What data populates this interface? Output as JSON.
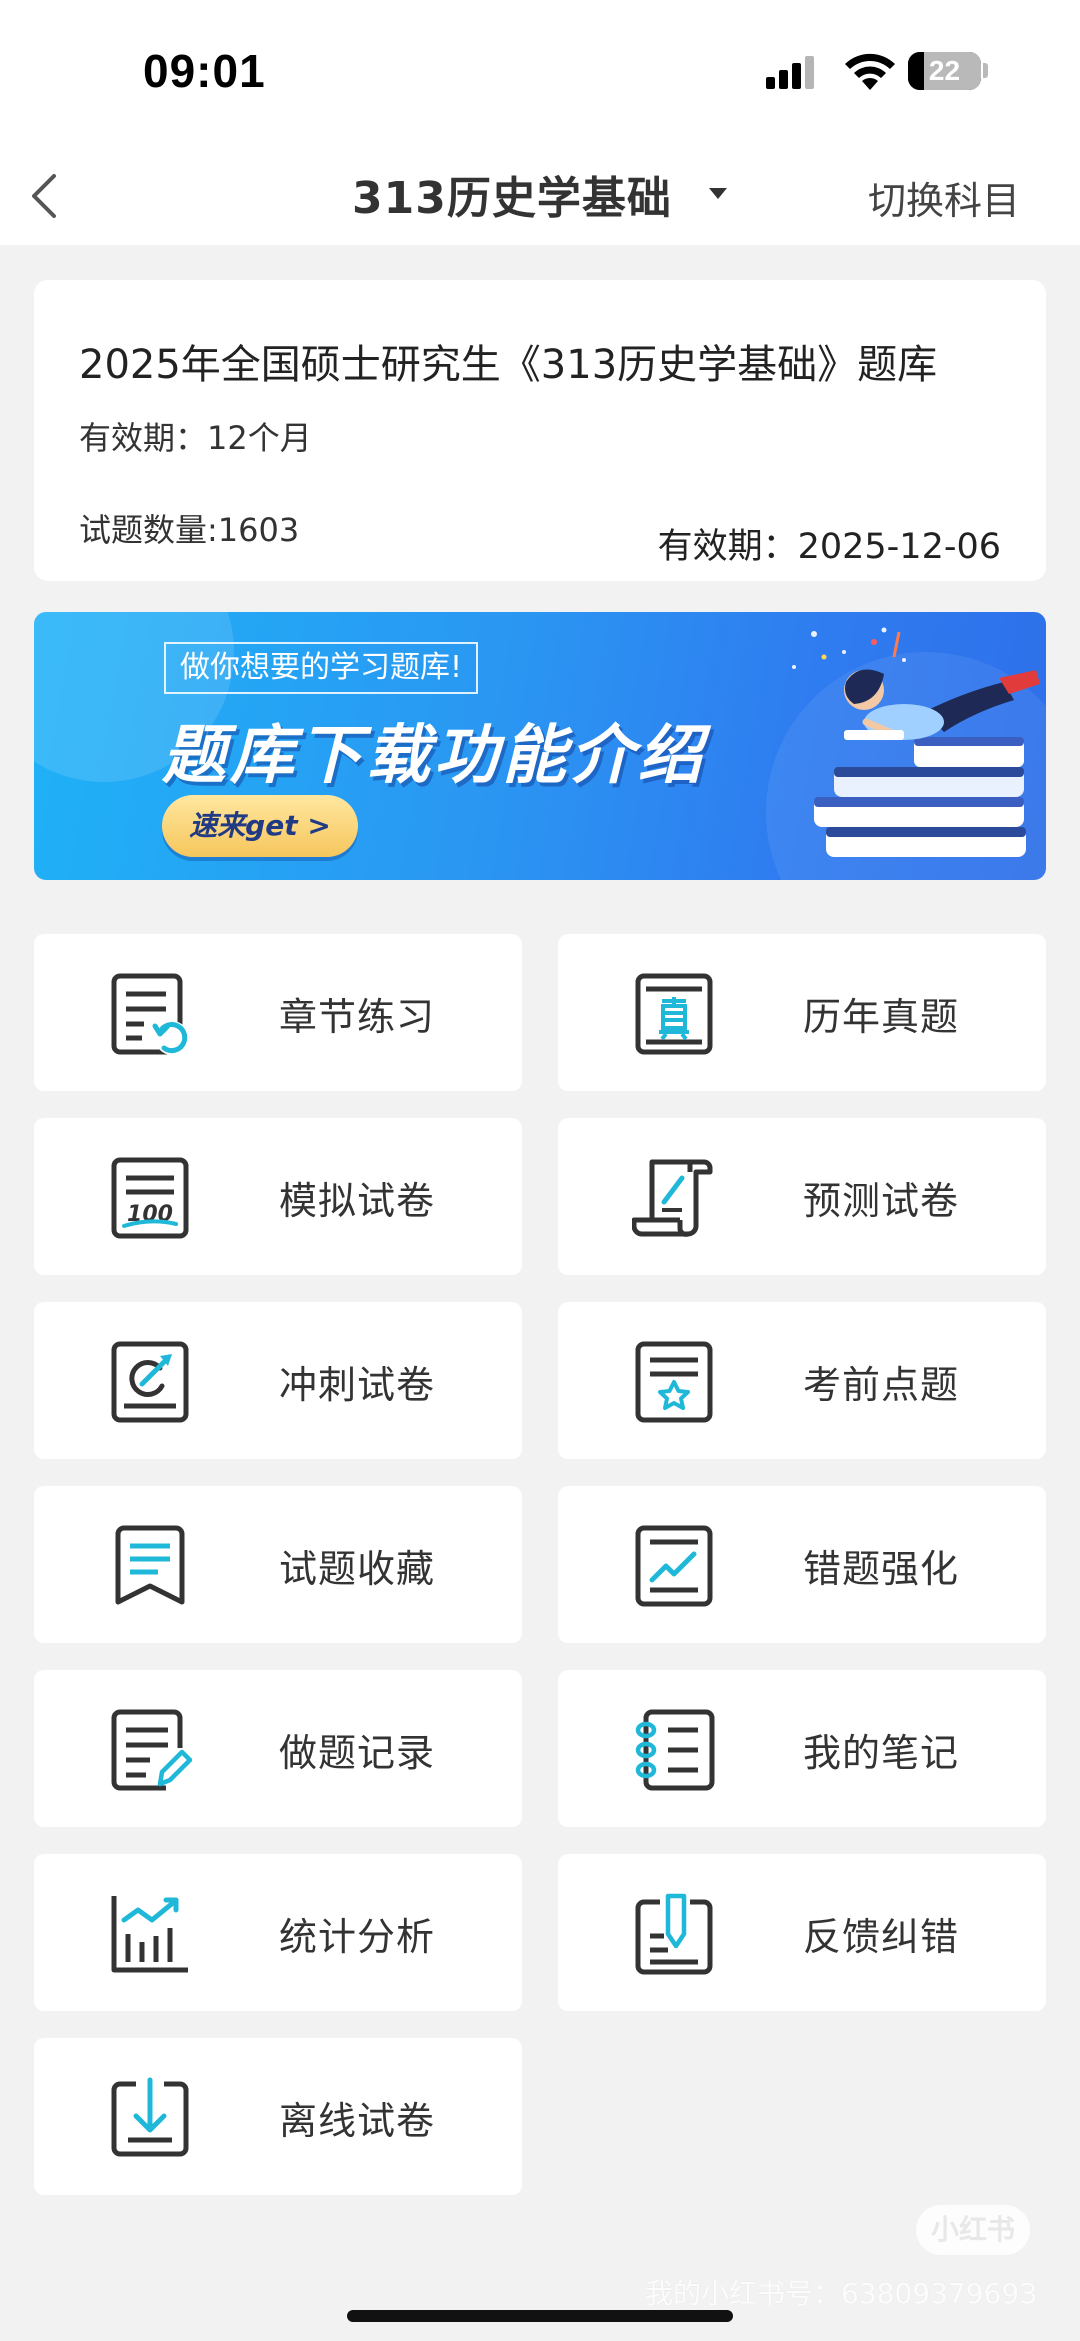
{
  "status_bar": {
    "time": "09:01",
    "battery": "22",
    "battery_level_percent": 22
  },
  "nav": {
    "title": "313历史学基础",
    "switch_label": "切换科目"
  },
  "info_card": {
    "title": "2025年全国硕士研究生《313历史学基础》题库",
    "validity": "有效期：12个月",
    "question_count": "试题数量:1603",
    "expire": "有效期：2025-12-06"
  },
  "banner": {
    "tag": "做你想要的学习题库!",
    "title": "题库下载功能介绍",
    "button": "速来get >"
  },
  "menu": [
    {
      "label": "章节练习",
      "icon": "chapter-practice-icon"
    },
    {
      "label": "历年真题",
      "icon": "past-exams-icon"
    },
    {
      "label": "模拟试卷",
      "icon": "mock-paper-icon"
    },
    {
      "label": "预测试卷",
      "icon": "forecast-paper-icon"
    },
    {
      "label": "冲刺试卷",
      "icon": "sprint-paper-icon"
    },
    {
      "label": "考前点题",
      "icon": "pre-exam-tips-icon"
    },
    {
      "label": "试题收藏",
      "icon": "favorites-icon"
    },
    {
      "label": "错题强化",
      "icon": "wrong-questions-icon"
    },
    {
      "label": "做题记录",
      "icon": "practice-record-icon"
    },
    {
      "label": "我的笔记",
      "icon": "notes-icon"
    },
    {
      "label": "统计分析",
      "icon": "statistics-icon"
    },
    {
      "label": "反馈纠错",
      "icon": "feedback-icon"
    },
    {
      "label": "离线试卷",
      "icon": "offline-download-icon"
    }
  ],
  "watermark": {
    "logo": "小红书",
    "text": "我的小红书号：6380937969З"
  },
  "colors": {
    "accent": "#1fb8d9",
    "icon_dark": "#333333",
    "background": "#f2f2f2"
  }
}
